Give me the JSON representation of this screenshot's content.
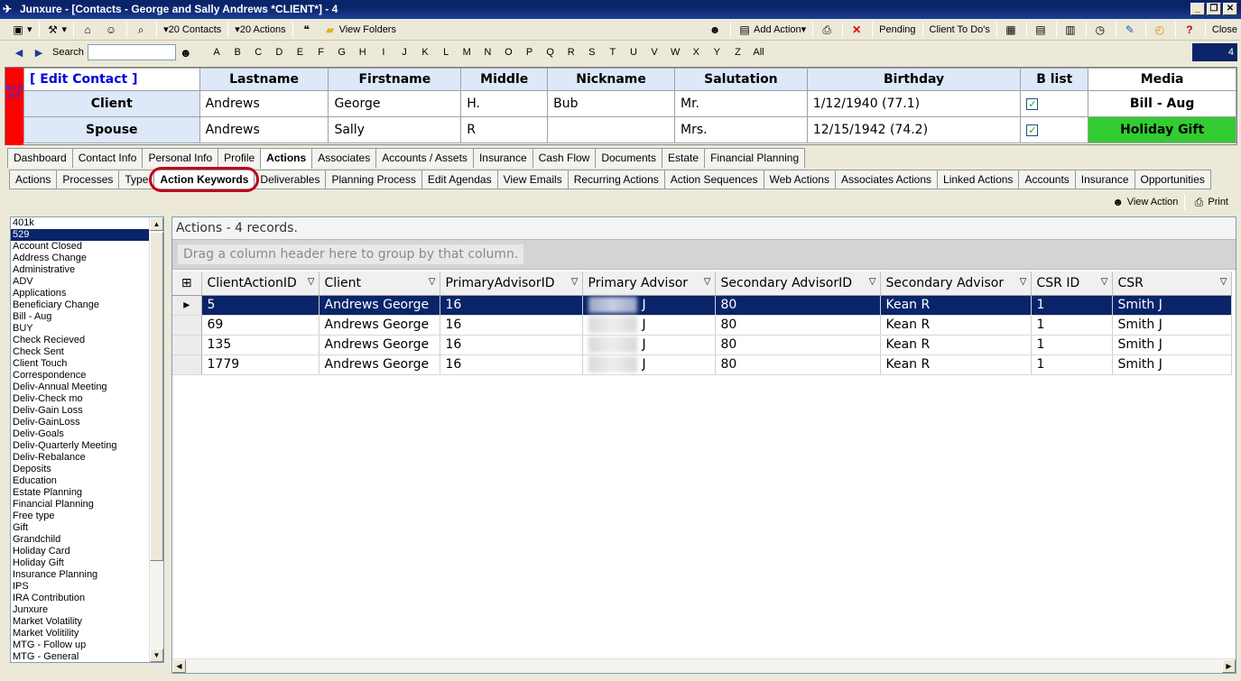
{
  "window": {
    "title": "Junxure - [Contacts - George and Sally Andrews  *CLIENT*] - 4"
  },
  "toolbar1": {
    "contacts": "20 Contacts",
    "actions": "20 Actions",
    "view_folders": "View Folders",
    "add_action": "Add Action",
    "pending": "Pending",
    "client_todos": "Client To Do's",
    "close": "Close"
  },
  "toolbar2": {
    "search_label": "Search",
    "letters": [
      "A",
      "B",
      "C",
      "D",
      "E",
      "F",
      "G",
      "H",
      "I",
      "J",
      "K",
      "L",
      "M",
      "N",
      "O",
      "P",
      "Q",
      "R",
      "S",
      "T",
      "U",
      "V",
      "W",
      "X",
      "Y",
      "Z",
      "All"
    ],
    "record_count": "4"
  },
  "contact": {
    "alert_text": "A L E R T",
    "edit_label": "[ Edit Contact ]",
    "headers": [
      "Lastname",
      "Firstname",
      "Middle",
      "Nickname",
      "Salutation",
      "Birthday",
      "B list",
      "Media"
    ],
    "client": {
      "label": "Client",
      "lastname": "Andrews",
      "firstname": "George",
      "middle": "H.",
      "nickname": "Bub",
      "salutation": "Mr.",
      "birthday": "1/12/1940 (77.1)",
      "blist": true,
      "media": "Bill - Aug"
    },
    "spouse": {
      "label": "Spouse",
      "lastname": "Andrews",
      "firstname": "Sally",
      "middle": "R",
      "nickname": "",
      "salutation": "Mrs.",
      "birthday": "12/15/1942 (74.2)",
      "blist": true,
      "media": "Holiday Gift",
      "media_color": "#33cc33"
    }
  },
  "tabs": [
    "Dashboard",
    "Contact Info",
    "Personal Info",
    "Profile",
    "Actions",
    "Associates",
    "Accounts / Assets",
    "Insurance",
    "Cash Flow",
    "Documents",
    "Estate",
    "Financial Planning"
  ],
  "subtabs": [
    "Actions",
    "Processes",
    "Type",
    "Action Keywords",
    "Deliverables",
    "Planning Process",
    "Edit Agendas",
    "View Emails",
    "Recurring Actions",
    "Action Sequences",
    "Web Actions",
    "Associates Actions",
    "Linked Actions",
    "Accounts",
    "Insurance",
    "Opportunities"
  ],
  "toolbar3": {
    "view_action": "View Action",
    "print": "Print"
  },
  "keywords": [
    "401k",
    "529",
    "Account Closed",
    "Address Change",
    "Administrative",
    "ADV",
    "Applications",
    "Beneficiary Change",
    "Bill - Aug",
    "BUY",
    "Check Recieved",
    "Check Sent",
    "Client Touch",
    "Correspondence",
    "Deliv-Annual Meeting",
    "Deliv-Check mo",
    "Deliv-Gain  Loss",
    "Deliv-GainLoss",
    "Deliv-Goals",
    "Deliv-Quarterly Meeting",
    "Deliv-Rebalance",
    "Deposits",
    "Education",
    "Estate Planning",
    "Financial Planning",
    "Free type",
    "Gift",
    "Grandchild",
    "Holiday Card",
    "Holiday Gift",
    "Insurance Planning",
    "IPS",
    "IRA Contribution",
    "Junxure",
    "Market Volatility",
    "Market Volitility",
    "MTG - Follow up",
    "MTG - General"
  ],
  "grid": {
    "caption": "Actions - 4 records.",
    "group_hint": "Drag a column header here to group by that column.",
    "columns": [
      "ClientActionID",
      "Client",
      "PrimaryAdvisorID",
      "Primary Advisor",
      "Secondary AdvisorID",
      "Secondary Advisor",
      "CSR ID",
      "CSR"
    ],
    "rows": [
      [
        "5",
        "Andrews George",
        "16",
        "J",
        "80",
        "Kean R",
        "1",
        "Smith J"
      ],
      [
        "69",
        "Andrews George",
        "16",
        "J",
        "80",
        "Kean R",
        "1",
        "Smith J"
      ],
      [
        "135",
        "Andrews George",
        "16",
        "J",
        "80",
        "Kean R",
        "1",
        "Smith J"
      ],
      [
        "1779",
        "Andrews George",
        "16",
        "J",
        "80",
        "Kean R",
        "1",
        "Smith J"
      ]
    ]
  }
}
